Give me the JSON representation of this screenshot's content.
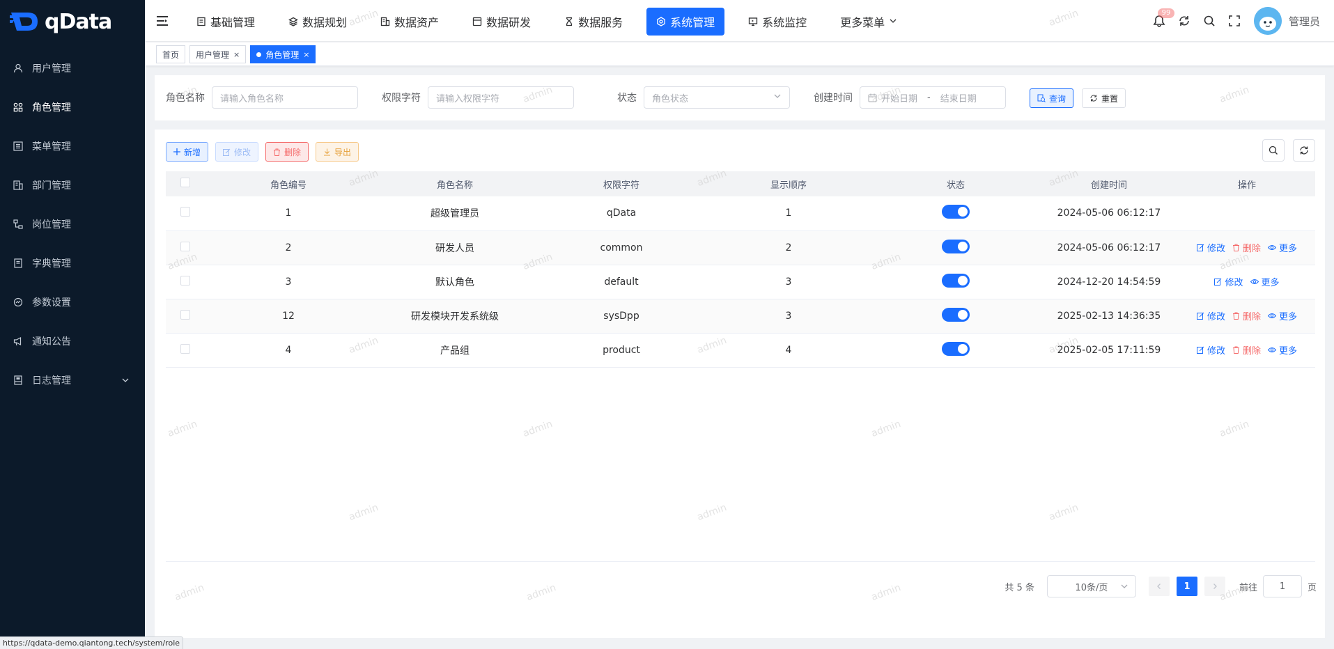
{
  "app": {
    "logo_text": "qData",
    "brand_color": "#1a6dff"
  },
  "sidebar": {
    "items": [
      {
        "label": "用户管理",
        "icon": "user-icon"
      },
      {
        "label": "角色管理",
        "icon": "role-icon"
      },
      {
        "label": "菜单管理",
        "icon": "menu-list-icon"
      },
      {
        "label": "部门管理",
        "icon": "department-icon"
      },
      {
        "label": "岗位管理",
        "icon": "post-icon"
      },
      {
        "label": "字典管理",
        "icon": "dictionary-icon"
      },
      {
        "label": "参数设置",
        "icon": "settings-icon"
      },
      {
        "label": "通知公告",
        "icon": "megaphone-icon"
      },
      {
        "label": "日志管理",
        "icon": "log-icon"
      }
    ]
  },
  "topnav": {
    "items": [
      {
        "label": "基础管理",
        "icon": "base-icon"
      },
      {
        "label": "数据规划",
        "icon": "layers-icon"
      },
      {
        "label": "数据资产",
        "icon": "asset-icon"
      },
      {
        "label": "数据研发",
        "icon": "dev-icon"
      },
      {
        "label": "数据服务",
        "icon": "hourglass-icon"
      },
      {
        "label": "系统管理",
        "icon": "system-icon"
      },
      {
        "label": "系统监控",
        "icon": "monitor-icon"
      },
      {
        "label": "更多菜单",
        "icon": "chevron-down-icon"
      }
    ],
    "active_index": 5,
    "notification_badge": "99",
    "user_name": "管理员"
  },
  "tags": {
    "items": [
      {
        "label": "首页",
        "closable": false
      },
      {
        "label": "用户管理",
        "closable": true
      },
      {
        "label": "角色管理",
        "closable": true
      }
    ],
    "close_symbol": "×"
  },
  "search": {
    "role_name_label": "角色名称",
    "role_name_placeholder": "请输入角色名称",
    "role_key_label": "权限字符",
    "role_key_placeholder": "请输入权限字符",
    "status_label": "状态",
    "status_placeholder": "角色状态",
    "created_label": "创建时间",
    "start_placeholder": "开始日期",
    "range_separator": "-",
    "end_placeholder": "结束日期",
    "query_label": "查询",
    "reset_label": "重置"
  },
  "toolbar": {
    "add_label": "新增",
    "edit_label": "修改",
    "delete_label": "删除",
    "export_label": "导出"
  },
  "table": {
    "columns": [
      "角色编号",
      "角色名称",
      "权限字符",
      "显示顺序",
      "状态",
      "创建时间",
      "操作"
    ],
    "rows": [
      {
        "id": "1",
        "name": "超级管理员",
        "key": "qData",
        "order": "1",
        "enabled": true,
        "created": "2024-05-06 06:12:17",
        "actions": []
      },
      {
        "id": "2",
        "name": "研发人员",
        "key": "common",
        "order": "2",
        "enabled": true,
        "created": "2024-05-06 06:12:17",
        "actions": [
          "edit",
          "delete",
          "more"
        ]
      },
      {
        "id": "3",
        "name": "默认角色",
        "key": "default",
        "order": "3",
        "enabled": true,
        "created": "2024-12-20 14:54:59",
        "actions": [
          "edit",
          "more"
        ]
      },
      {
        "id": "12",
        "name": "研发模块开发系统级",
        "key": "sysDpp",
        "order": "3",
        "enabled": true,
        "created": "2025-02-13 14:36:35",
        "actions": [
          "edit",
          "delete",
          "more"
        ]
      },
      {
        "id": "4",
        "name": "产品组",
        "key": "product",
        "order": "4",
        "enabled": true,
        "created": "2025-02-05 17:11:59",
        "actions": [
          "edit",
          "delete",
          "more"
        ]
      }
    ],
    "action_labels": {
      "edit": "修改",
      "delete": "删除",
      "more": "更多"
    }
  },
  "pagination": {
    "total_text": "共 5 条",
    "page_size": "10条/页",
    "current_page": "1",
    "goto_label": "前往",
    "goto_value": "1",
    "page_suffix": "页"
  },
  "watermark_text": "admin",
  "status_url": "https://qdata-demo.qiantong.tech/system/role"
}
